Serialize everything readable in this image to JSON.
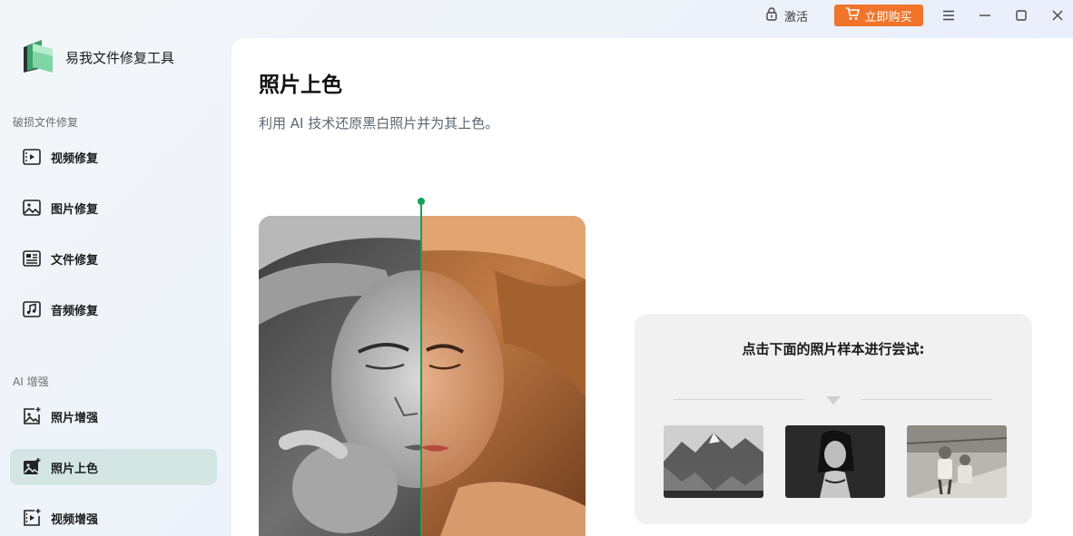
{
  "titlebar": {
    "activate_label": "激活",
    "buy_label": "立即购买",
    "buy_color": "#f0742a",
    "icons": [
      "lock-icon",
      "cart-icon",
      "menu-icon",
      "minimize-icon",
      "maximize-icon",
      "close-icon"
    ]
  },
  "app": {
    "name": "易我文件修复工具"
  },
  "sidebar": {
    "sections": [
      {
        "title": "破损文件修复"
      },
      {
        "title": "AI 增强"
      }
    ],
    "items": [
      {
        "label": "视频修复",
        "icon": "video-icon"
      },
      {
        "label": "图片修复",
        "icon": "image-icon"
      },
      {
        "label": "文件修复",
        "icon": "document-icon"
      },
      {
        "label": "音频修复",
        "icon": "music-icon"
      },
      {
        "label": "照片增强",
        "icon": "photo-enhance-icon"
      },
      {
        "label": "照片上色",
        "icon": "photo-colorize-icon",
        "active": true
      },
      {
        "label": "视频增强",
        "icon": "video-enhance-icon"
      }
    ],
    "active_color": "#d3e6e4"
  },
  "main": {
    "title": "照片上色",
    "subtitle": "利用 AI 技术还原黑白照片并为其上色。",
    "divider_color": "#18a05a",
    "samples": {
      "title": "点击下面的照片样本进行尝试:",
      "items": [
        "sample-landscape",
        "sample-portrait",
        "sample-children"
      ]
    }
  }
}
